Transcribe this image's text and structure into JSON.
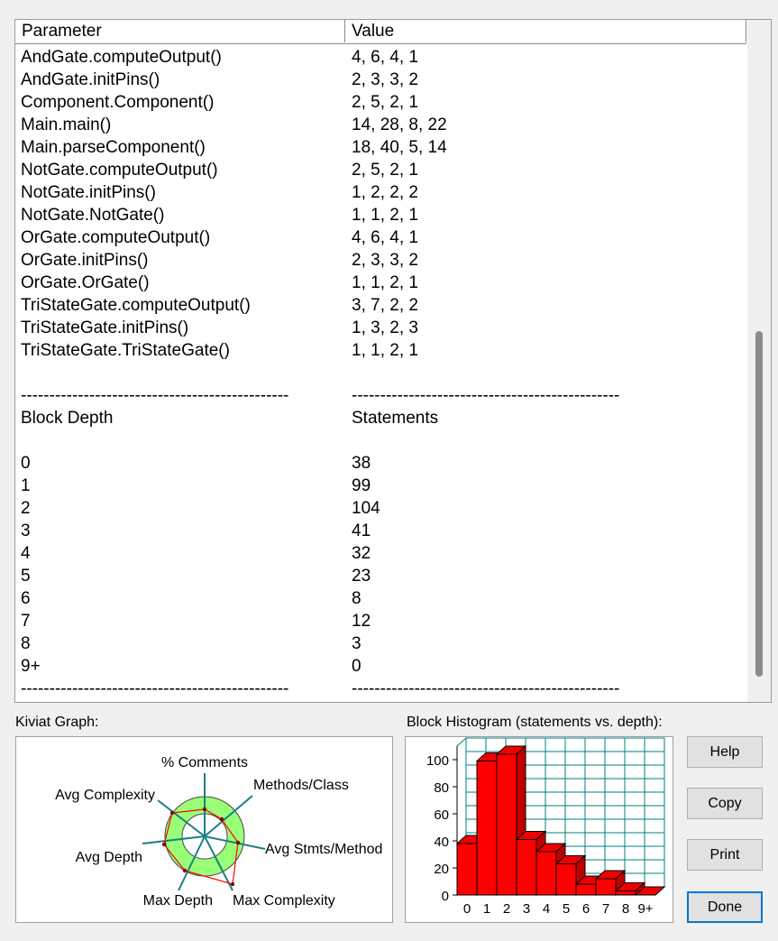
{
  "table": {
    "headers": {
      "parameter": "Parameter",
      "value": "Value"
    },
    "rows": [
      {
        "p": "AndGate.computeOutput()",
        "v": "4, 6, 4, 1"
      },
      {
        "p": "AndGate.initPins()",
        "v": "2, 3, 3, 2"
      },
      {
        "p": "Component.Component()",
        "v": "2, 5, 2, 1"
      },
      {
        "p": "Main.main()",
        "v": "14, 28, 8, 22"
      },
      {
        "p": "Main.parseComponent()",
        "v": "18, 40, 5, 14"
      },
      {
        "p": "NotGate.computeOutput()",
        "v": "2, 5, 2, 1"
      },
      {
        "p": "NotGate.initPins()",
        "v": "1, 2, 2, 2"
      },
      {
        "p": "NotGate.NotGate()",
        "v": "1, 1, 2, 1"
      },
      {
        "p": "OrGate.computeOutput()",
        "v": "4, 6, 4, 1"
      },
      {
        "p": "OrGate.initPins()",
        "v": "2, 3, 3, 2"
      },
      {
        "p": "OrGate.OrGate()",
        "v": "1, 1, 2, 1"
      },
      {
        "p": "TriStateGate.computeOutput()",
        "v": "3, 7, 2, 2"
      },
      {
        "p": "TriStateGate.initPins()",
        "v": "1, 3, 2, 3"
      },
      {
        "p": "TriStateGate.TriStateGate()",
        "v": "1, 1, 2, 1"
      },
      {
        "p": "",
        "v": ""
      },
      {
        "p": "-----------------------------------------------",
        "v": "-----------------------------------------------"
      },
      {
        "p": "Block Depth",
        "v": "Statements"
      },
      {
        "p": "",
        "v": ""
      },
      {
        "p": "0",
        "v": "38"
      },
      {
        "p": "1",
        "v": "99"
      },
      {
        "p": "2",
        "v": "104"
      },
      {
        "p": "3",
        "v": "41"
      },
      {
        "p": "4",
        "v": "32"
      },
      {
        "p": "5",
        "v": "23"
      },
      {
        "p": "6",
        "v": "8"
      },
      {
        "p": "7",
        "v": "12"
      },
      {
        "p": "8",
        "v": "3"
      },
      {
        "p": "9+",
        "v": "0"
      },
      {
        "p": "-----------------------------------------------",
        "v": "-----------------------------------------------"
      }
    ]
  },
  "kiviat": {
    "caption": "Kiviat Graph:",
    "axes": [
      "% Comments",
      "Methods/Class",
      "Avg Stmts/Method",
      "Max Complexity",
      "Max Depth",
      "Avg Depth",
      "Avg Complexity"
    ]
  },
  "histogram": {
    "caption": "Block Histogram (statements vs. depth):"
  },
  "buttons": {
    "help": "Help",
    "copy": "Copy",
    "print": "Print",
    "done": "Done"
  },
  "colors": {
    "bar_front": "#ff0000",
    "bar_top": "#ee0000",
    "bar_side": "#c00000",
    "grid": "#008080",
    "kiviat_ring": "#99ff77",
    "kiviat_polygon": "#ff0000"
  },
  "chart_data": {
    "type": "bar",
    "categories": [
      "0",
      "1",
      "2",
      "3",
      "4",
      "5",
      "6",
      "7",
      "8",
      "9+"
    ],
    "values": [
      38,
      99,
      104,
      41,
      32,
      23,
      8,
      12,
      3,
      0
    ],
    "yticks": [
      "0",
      "20",
      "40",
      "60",
      "80",
      "100"
    ],
    "ylim": [
      0,
      110
    ],
    "grid": true,
    "style": "3d"
  }
}
